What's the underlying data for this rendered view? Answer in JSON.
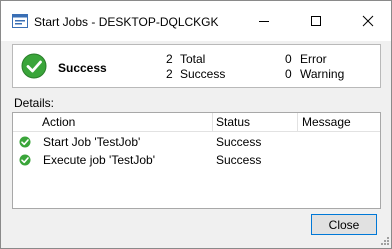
{
  "window": {
    "title": "Start Jobs - DESKTOP-DQLCKGK"
  },
  "summary": {
    "status": "Success",
    "total_count": "2",
    "total_label": "Total",
    "success_count": "2",
    "success_label": "Success",
    "error_count": "0",
    "error_label": "Error",
    "warning_count": "0",
    "warning_label": "Warning"
  },
  "details": {
    "label": "Details:",
    "columns": [
      "Action",
      "Status",
      "Message"
    ],
    "rows": [
      {
        "action": "Start Job 'TestJob'",
        "status": "Success",
        "message": ""
      },
      {
        "action": "Execute job 'TestJob'",
        "status": "Success",
        "message": ""
      }
    ]
  },
  "buttons": {
    "close": "Close"
  },
  "colors": {
    "success_green": "#3aa53a",
    "focus_border": "#0078d7"
  },
  "icons": {
    "app": "ssms-app-icon",
    "status": "check-circle-icon"
  }
}
